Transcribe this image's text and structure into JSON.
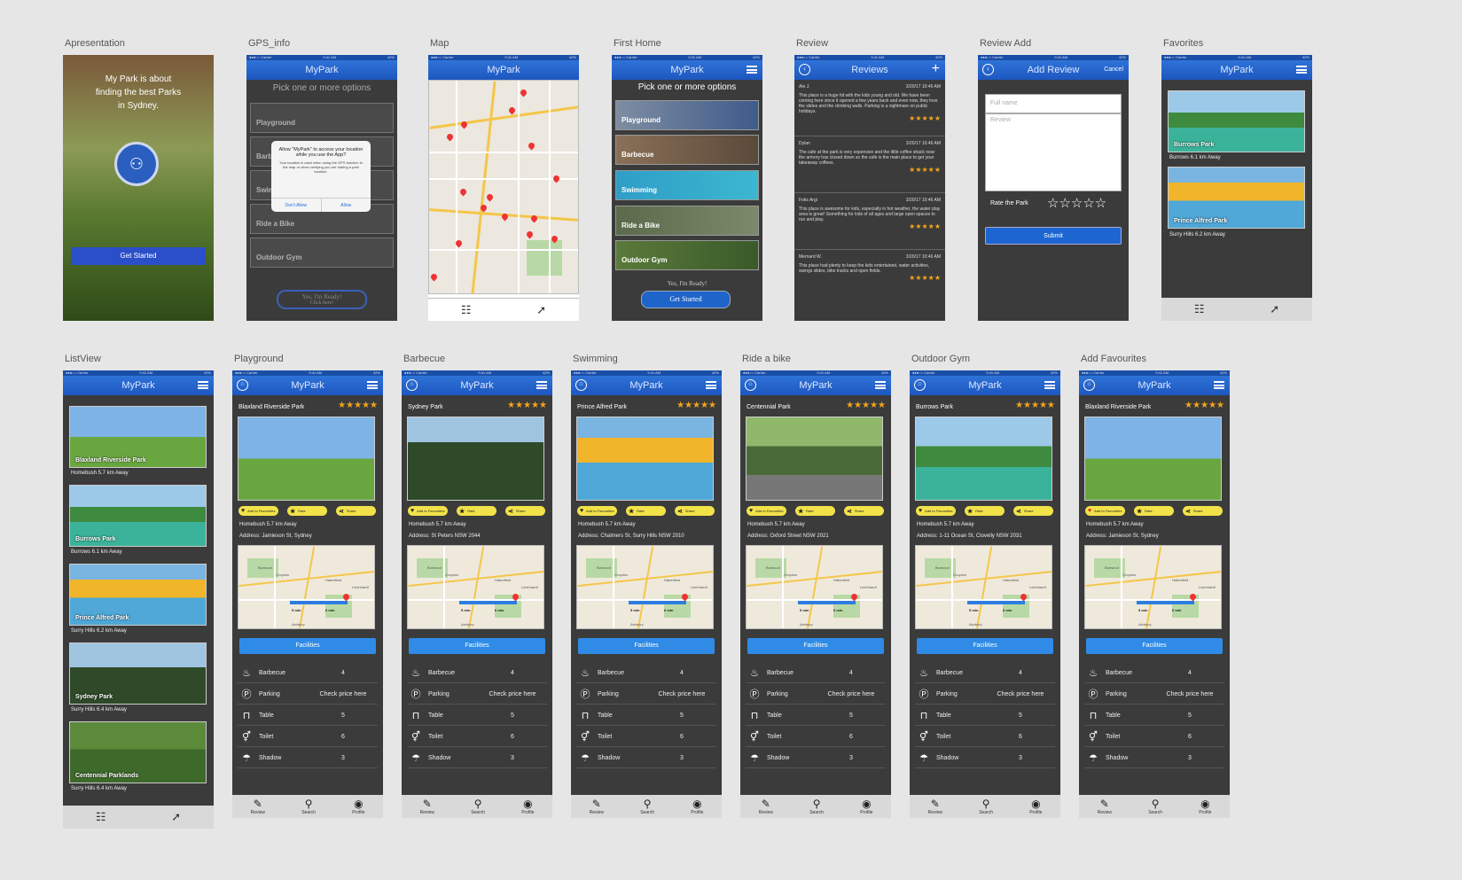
{
  "status": {
    "carrier": "●●●○○ Carrier",
    "time": "9:41 AM",
    "battery": "42%"
  },
  "app_title": "MyPark",
  "labels": {
    "apresentacao": "Apresentation",
    "gps": "GPS_info",
    "map": "Map",
    "first_home": "First Home",
    "review": "Review",
    "review_add": "Review Add",
    "favorites": "Favorites",
    "listview": "ListView",
    "playground": "Playground",
    "barbecue": "Barbecue",
    "swimming": "Swimming",
    "ride": "Ride a bike",
    "outdoor": "Outdoor Gym",
    "add_fav": "Add Favourites"
  },
  "splash": {
    "tagline": "My Park is about finding the best Parks in Sydney.",
    "cta": "Get Started"
  },
  "options": {
    "prompt": "Pick one or more options",
    "items": [
      "Playground",
      "Barbecue",
      "Swimming",
      "Ride a Bike",
      "Outdoor Gym"
    ],
    "ready": "Yes, I'm Ready!",
    "click": "Click here!",
    "cta": "Get Started"
  },
  "gps_alert": {
    "title": "Allow \"MyPark\" to access your location while you use the App?",
    "body": "Your location is used when using the GPS function in the map or when verifying you are visiting a park location.",
    "deny": "Don't Allow",
    "allow": "Allow"
  },
  "reviews": {
    "title": "Reviews",
    "items": [
      {
        "name": "Ale J.",
        "date": "3/20/17 10:46 AM",
        "text": "This place is a huge hit with the kids young and old. We have been coming here since it opened a few years back and even now, they love the slides and the climbing walls. Parking is a nightmare on public holidays.",
        "stars": "★★★★★"
      },
      {
        "name": "Dylan",
        "date": "3/20/17 10:46 AM",
        "text": "The cafe at the park is very expensive and the little coffee shack near the armory has closed down so the cafe is the main place to get your takeaway coffees.",
        "stars": "★★★★★"
      },
      {
        "name": "Fotis Argi",
        "date": "3/20/17 10:46 AM",
        "text": "This place is awesome for kids, especially in hot weather, the water play area is great! Something for kids of all ages and large open spaces to run and play.",
        "stars": "★★★★★"
      },
      {
        "name": "Mernard W.",
        "date": "3/20/17 10:46 AM",
        "text": "This place had plenty to keep the kids entertained, water activities, swings slides, bike tracks and open fields.",
        "stars": "★★★★★"
      }
    ]
  },
  "add_review": {
    "title": "Add Review",
    "cancel": "Cancel",
    "name_ph": "Full name",
    "review_ph": "Review",
    "rate": "Rate the Park",
    "stars": "☆☆☆☆☆",
    "submit": "Submit"
  },
  "favorites": [
    {
      "name": "Burrows Park",
      "sub": "Burrows   6.1 km Away"
    },
    {
      "name": "Prince Alfred Park",
      "sub": "Surry Hills   6.2 km Away"
    }
  ],
  "list": [
    {
      "name": "Blaxland Riverside Park",
      "sub": "Homebush   5.7 km Away"
    },
    {
      "name": "Burrows Park",
      "sub": "Burrows   6.1 km Away"
    },
    {
      "name": "Prince Alfred Park",
      "sub": "Surry Hills   6.2 km Away"
    },
    {
      "name": "Sydney Park",
      "sub": "Surry Hills   6.4 km Away"
    },
    {
      "name": "Centennial Parklands",
      "sub": "Surry Hills   6.4 km Away"
    }
  ],
  "details": [
    {
      "park": "Blaxland Riverside Park",
      "dist": "Homebush   5.7 km Away",
      "addr": "Address: Jamieson St, Sydney"
    },
    {
      "park": "Sydney Park",
      "dist": "Homebush   5.7 km Away",
      "addr": "Address: St Peters NSW 2044"
    },
    {
      "park": "Prince Alfred Park",
      "dist": "Homebush   5.7 km Away",
      "addr": "Address: Chalmers St, Surry Hills NSW 2010"
    },
    {
      "park": "Centennial Park",
      "dist": "Homebush   5.7 km Away",
      "addr": "Address: Oxford Street NSW 2021"
    },
    {
      "park": "Burrows Park",
      "dist": "Homebush   5.7 km Away",
      "addr": "Address: 1-11 Ocean St, Clovelly NSW 2031"
    },
    {
      "park": "Blaxland Riverside Park",
      "dist": "Homebush   5.7 km Away",
      "addr": "Address: Jamieson St, Sydney"
    }
  ],
  "detail_common": {
    "stars": "★★★★★",
    "fav": "Add to Favourites",
    "rate": "Rate",
    "share": "Share",
    "facilities": "Facilities",
    "rows": [
      {
        "name": "Barbecue",
        "value": "4"
      },
      {
        "name": "Parking",
        "value": "Check price here"
      },
      {
        "name": "Table",
        "value": "5"
      },
      {
        "name": "Toilet",
        "value": "6"
      },
      {
        "name": "Shadow",
        "value": "3"
      }
    ],
    "tabs": [
      "Review",
      "Search",
      "Profile"
    ],
    "map_texts": [
      "Burwood",
      "Croydon",
      "Haberfield",
      "Leichhardt",
      "Ashbury",
      "5 min",
      "6 min"
    ]
  },
  "colors": {
    "accent": "#2f8be6",
    "nav": "#1d57c0",
    "star": "#f2a51c",
    "pill": "#f2e24a",
    "bg": "#3b3b3b",
    "heart_active": "#e02020"
  }
}
